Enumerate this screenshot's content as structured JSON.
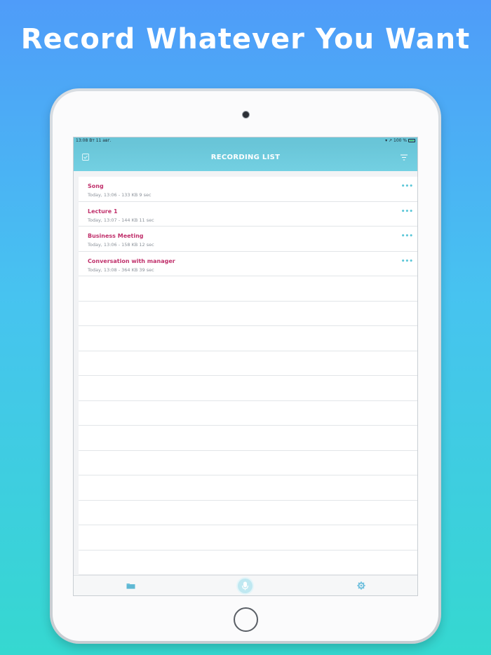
{
  "headline": "Record Whatever You Want",
  "status": {
    "time": "13:08",
    "date": "Вт 11 авг.",
    "battery": "100 %"
  },
  "nav": {
    "title": "RECORDING LIST",
    "left_icon": "select-icon",
    "right_icon": "filter-icon"
  },
  "recordings": [
    {
      "title": "Song",
      "meta": "Today, 13:06 - 133 KB   9 sec",
      "more": "•••"
    },
    {
      "title": "Lecture 1",
      "meta": "Today, 13:07 - 144 KB   11 sec",
      "more": "•••"
    },
    {
      "title": "Business Meeting",
      "meta": "Today, 13:06 - 158 KB   12 sec",
      "more": "•••"
    },
    {
      "title": "Conversation with manager",
      "meta": "Today, 13:08 - 364 KB   39 sec",
      "more": "•••"
    }
  ],
  "tabs": [
    {
      "icon": "folder-icon"
    },
    {
      "icon": "microphone-icon"
    },
    {
      "icon": "gear-icon"
    }
  ],
  "colors": {
    "accent": "#69c5d8",
    "title": "#c0306b",
    "meta": "#8a9199"
  }
}
